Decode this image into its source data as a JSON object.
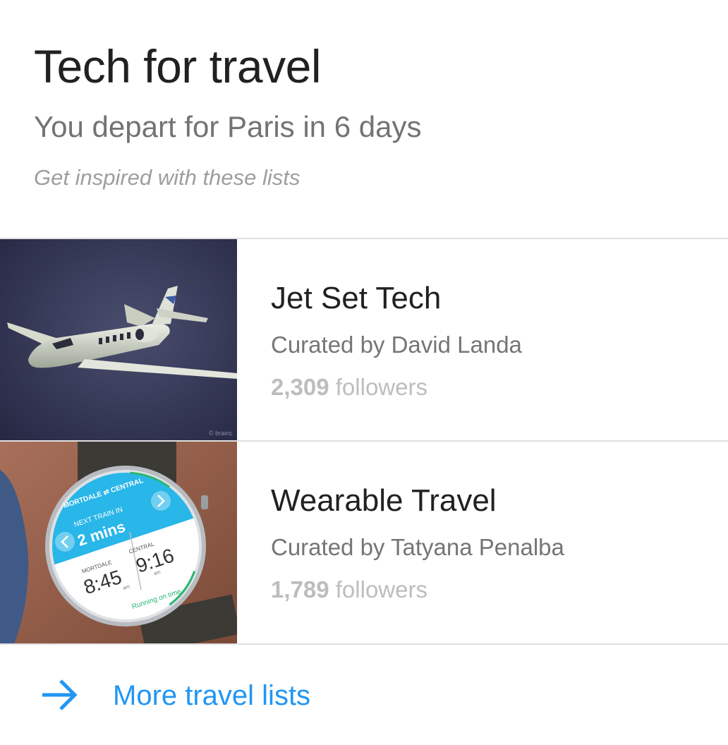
{
  "card": {
    "title": "Tech for travel",
    "subtitle": "You depart for Paris in 6 days",
    "hint": "Get inspired with these lists"
  },
  "lists": [
    {
      "title": "Jet Set Tech",
      "curator": "Curated by David Landa",
      "followers_count": "2,309",
      "followers_label": " followers",
      "image_icon": "jet-airplane-image",
      "image_credit": "© brainc"
    },
    {
      "title": "Wearable Travel",
      "curator": "Curated by Tatyana Penalba",
      "followers_count": "1,789",
      "followers_label": " followers",
      "image_icon": "smartwatch-image",
      "watch": {
        "route": "MORTDALE ⇄ CENTRAL",
        "next_label": "NEXT TRAIN IN",
        "next_value": "2 mins",
        "left_station": "MORTDALE",
        "left_time": "8:45",
        "right_station": "CENTRAL",
        "right_time": "9:16",
        "am": "am",
        "status": "Running on time"
      }
    }
  ],
  "footer": {
    "more_label": "More travel lists",
    "icon": "arrow-right-icon"
  },
  "colors": {
    "accent": "#2196f3",
    "title": "#212121",
    "secondary": "#757575",
    "muted": "#bdbdbd",
    "divider": "#e0e0e0"
  }
}
